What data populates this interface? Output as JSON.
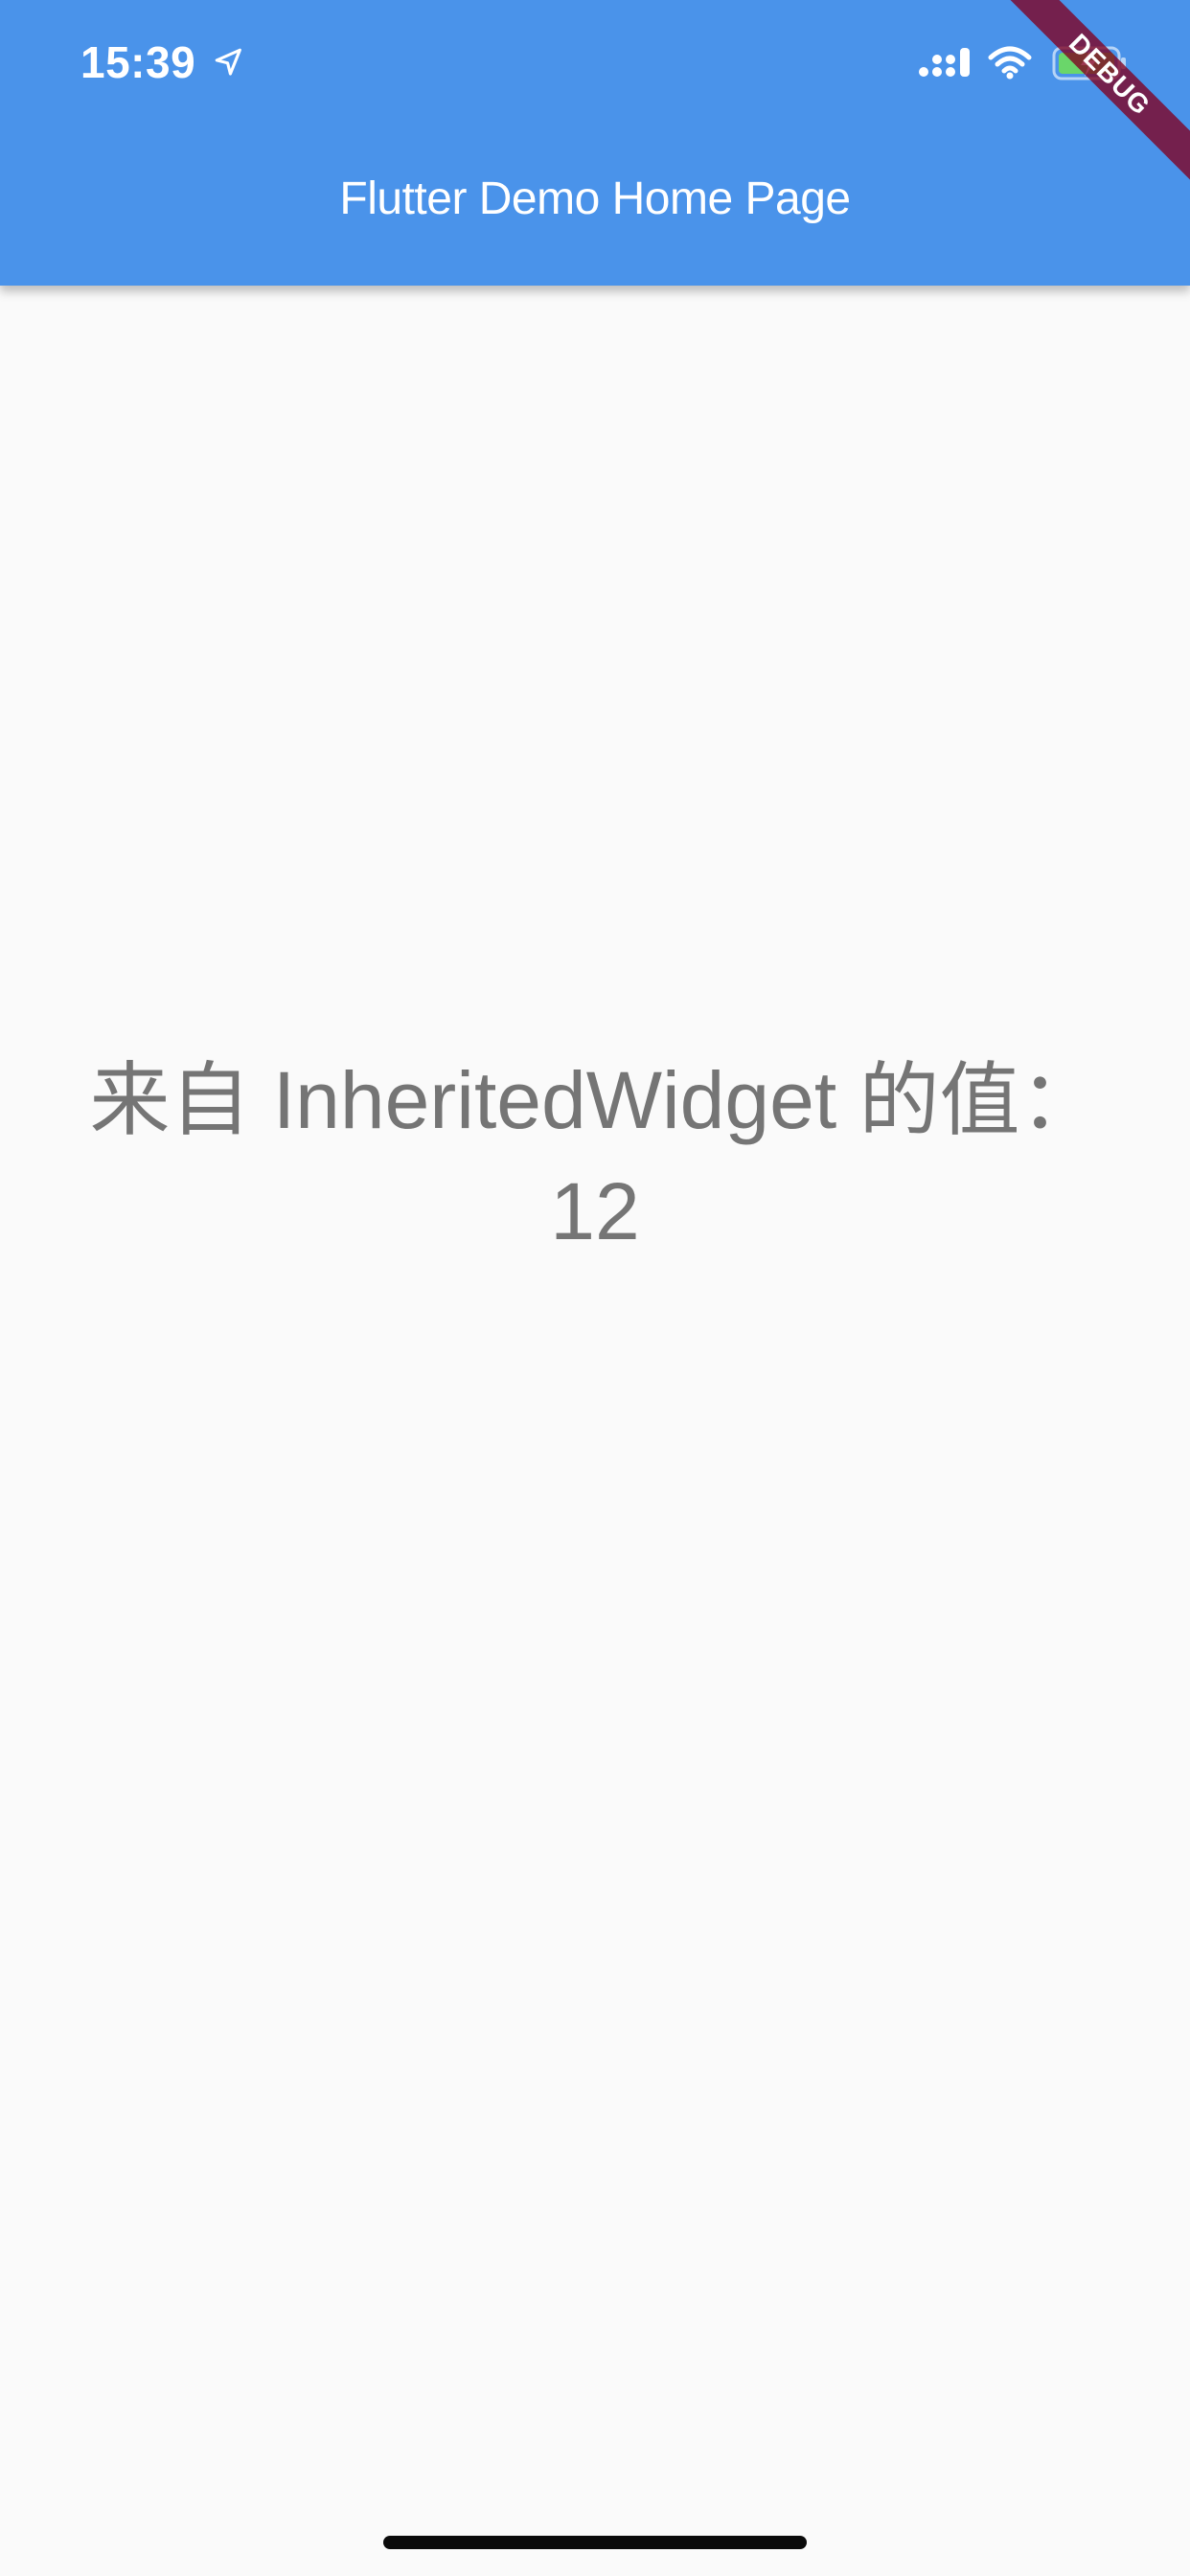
{
  "status_bar": {
    "time": "15:39",
    "icons": [
      "location-arrow-icon",
      "cellular-signal-icon",
      "wifi-icon",
      "battery-charging-icon"
    ]
  },
  "app_bar": {
    "title": "Flutter Demo Home Page",
    "color": "#4a93ea"
  },
  "debug_banner": {
    "label": "DEBUG"
  },
  "main": {
    "message_line1": "来自 InheritedWidget 的值：",
    "message_line2": "12"
  }
}
